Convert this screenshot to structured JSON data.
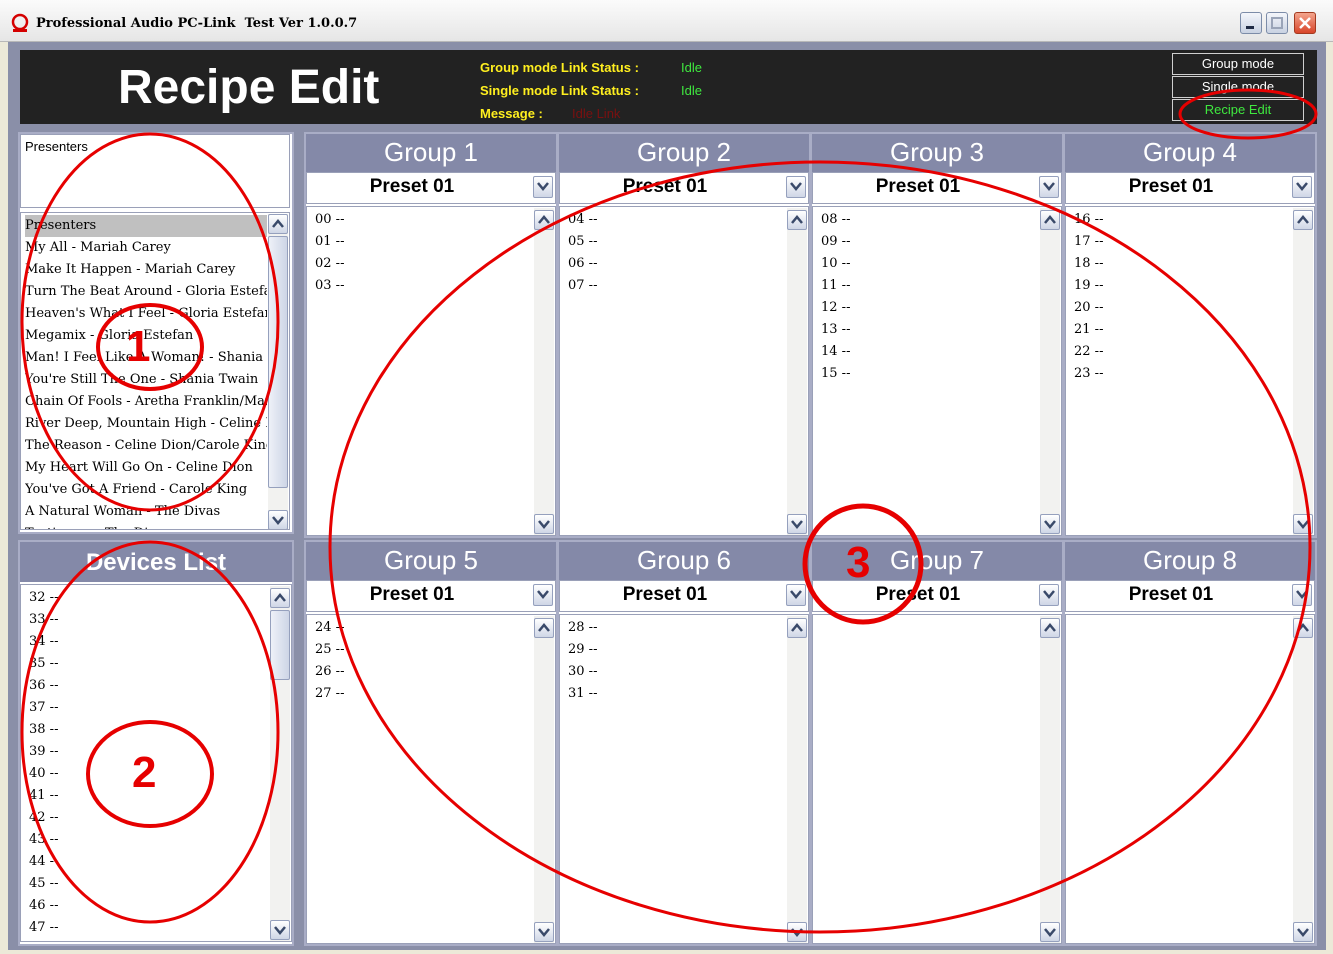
{
  "window": {
    "title": "Professional Audio PC-Link  Test Ver 1.0.0.7",
    "app_icon": "red-ring-icon",
    "controls": [
      "minimize-icon",
      "maximize-icon",
      "close-icon"
    ]
  },
  "header": {
    "title": "Recipe Edit",
    "group_status_label": "Group mode Link Status :",
    "group_status_value": "Idle",
    "single_status_label": "Single mode Link Status :",
    "single_status_value": "Idle",
    "message_label": "Message :",
    "message_value": "Idle Link"
  },
  "modes": [
    {
      "label": "Group mode",
      "active": false
    },
    {
      "label": "Single mode",
      "active": false
    },
    {
      "label": "Recipe Edit",
      "active": true
    }
  ],
  "presenters": {
    "label": "Presenters",
    "songs": [
      "Presenters",
      "My All - Mariah Carey",
      "Make It Happen - Mariah Carey",
      "Turn The Beat Around - Gloria Estefan",
      "Heaven's What I Feel - Gloria Estefan",
      "Megamix - Gloria Estefan",
      "Man! I Feel Like A Woman! - Shania Twain",
      "You're Still The One - Shania Twain",
      "Chain Of Fools - Aretha Franklin/Mariah Carey",
      "River Deep, Mountain High - Celine Dion",
      "The Reason - Celine Dion/Carole King",
      "My Heart Will Go On - Celine Dion",
      "You've Got A Friend - Carole King",
      "A Natural Woman - The Divas",
      "Testimony - The Divas"
    ]
  },
  "devices": {
    "title": "Devices List",
    "items": [
      "32 --",
      "33 --",
      "34 --",
      "35 --",
      "36 --",
      "37 --",
      "38 --",
      "39 --",
      "40 --",
      "41 --",
      "42 --",
      "43 --",
      "44 --",
      "45 --",
      "46 --",
      "47 --"
    ]
  },
  "groups": [
    {
      "name": "Group 1",
      "preset": "Preset 01",
      "items": [
        "00 --",
        "01 --",
        "02 --",
        "03 --"
      ]
    },
    {
      "name": "Group 2",
      "preset": "Preset 01",
      "items": [
        "04 --",
        "05 --",
        "06 --",
        "07 --"
      ]
    },
    {
      "name": "Group 3",
      "preset": "Preset 01",
      "items": [
        "08 --",
        "09 --",
        "10 --",
        "11 --",
        "12 --",
        "13 --",
        "14 --",
        "15 --"
      ]
    },
    {
      "name": "Group 4",
      "preset": "Preset 01",
      "items": [
        "16 --",
        "17 --",
        "18 --",
        "19 --",
        "20 --",
        "21 --",
        "22 --",
        "23 --"
      ]
    },
    {
      "name": "Group 5",
      "preset": "Preset 01",
      "items": [
        "24 --",
        "25 --",
        "26 --",
        "27 --"
      ]
    },
    {
      "name": "Group 6",
      "preset": "Preset 01",
      "items": [
        "28 --",
        "29 --",
        "30 --",
        "31 --"
      ]
    },
    {
      "name": "Group 7",
      "preset": "Preset 01",
      "items": []
    },
    {
      "name": "Group 8",
      "preset": "Preset 01",
      "items": []
    }
  ],
  "annotations": {
    "n1": "1",
    "n2": "2",
    "n3": "3",
    "color": "#e60000"
  }
}
